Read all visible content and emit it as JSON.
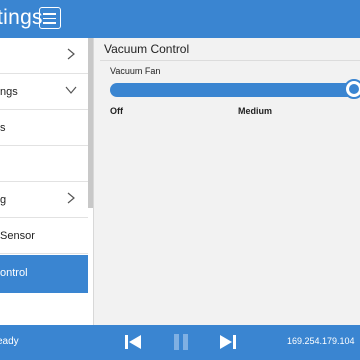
{
  "header": {
    "title": "tings"
  },
  "sidebar": {
    "items": [
      {
        "label": "",
        "chevron": "right"
      },
      {
        "label": "ngs",
        "chevron": "down"
      },
      {
        "label": "s"
      },
      {
        "label": ""
      },
      {
        "label": "g",
        "chevron": "right"
      },
      {
        "label": "Sensor"
      },
      {
        "label": "ontrol",
        "active": true
      }
    ]
  },
  "main": {
    "section_title": "Vacuum Control",
    "slider": {
      "label": "Vacuum Fan",
      "value_fraction": 1.0,
      "tick_labels": [
        "Off",
        "Medium"
      ]
    }
  },
  "footer": {
    "status": "eady",
    "ip_address": "169.254.179.104",
    "controls": [
      "skip-back-icon",
      "pause-icon",
      "skip-forward-icon"
    ]
  },
  "colors": {
    "accent": "#3a85d1",
    "background": "#f2f2f2",
    "sidebar": "#ffffff"
  }
}
